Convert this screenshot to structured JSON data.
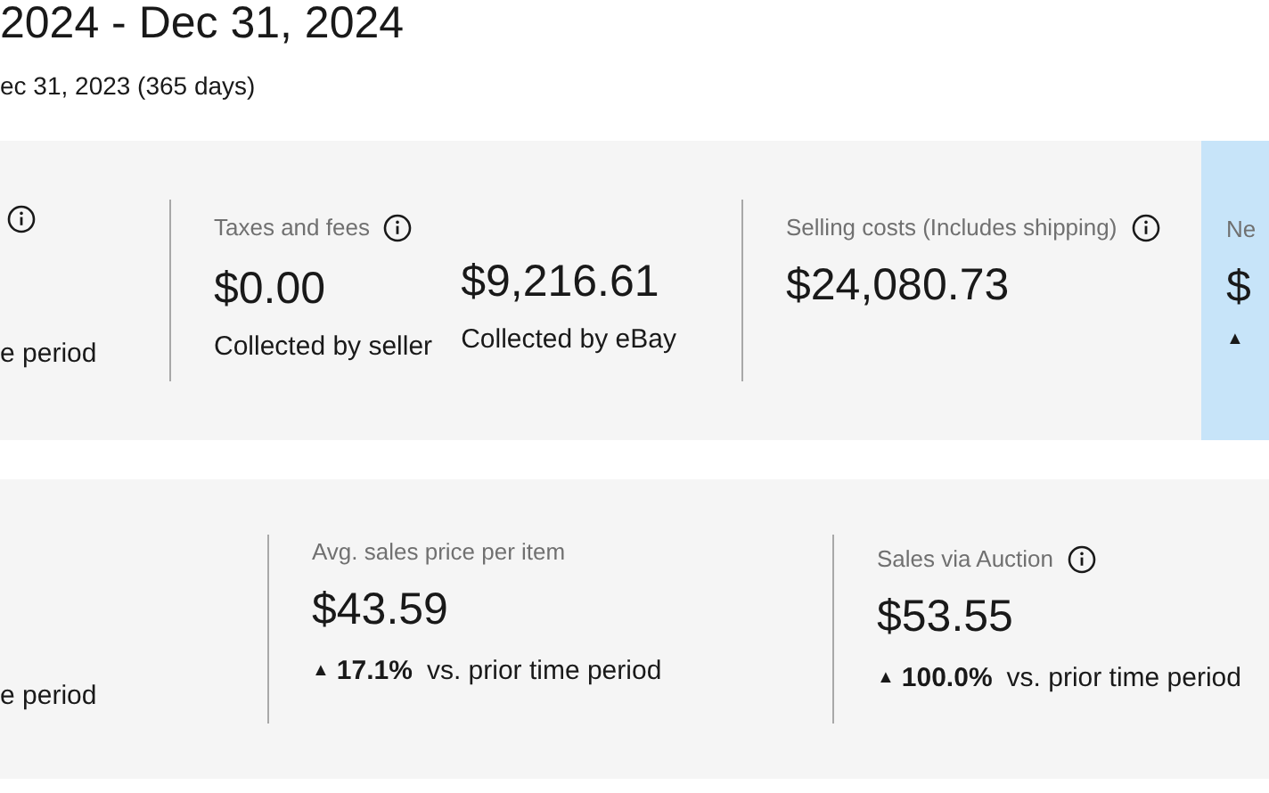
{
  "header": {
    "title": "2024 - Dec 31, 2024",
    "comparison": "ec 31, 2023 (365 days)"
  },
  "top_card": {
    "columns": [
      {
        "kind": "cut",
        "info": true,
        "note": "e period"
      },
      {
        "kind": "split",
        "label": "Taxes and fees",
        "info": true,
        "parts": [
          {
            "value": "$0.00",
            "caption": "Collected by seller"
          },
          {
            "value": "$9,216.61",
            "caption": "Collected by eBay"
          }
        ]
      },
      {
        "kind": "metric",
        "label": "Selling costs (Includes shipping)",
        "info": true,
        "value": "$24,080.73"
      }
    ],
    "highlight": {
      "label": "Ne",
      "value": "$",
      "arrow": "▲"
    }
  },
  "bottom_card": {
    "columns": [
      {
        "kind": "cut",
        "info": false,
        "note": "e period"
      },
      {
        "kind": "metric",
        "label": "Avg. sales price per item",
        "info": false,
        "value": "$43.59",
        "change": {
          "arrow": "▲",
          "percent": "17.1%",
          "text": "vs. prior time period"
        }
      },
      {
        "kind": "metric",
        "label": "Sales via Auction",
        "info": true,
        "value": "$53.55",
        "change": {
          "arrow": "▲",
          "percent": "100.0%",
          "text": "vs. prior time period"
        }
      }
    ]
  }
}
